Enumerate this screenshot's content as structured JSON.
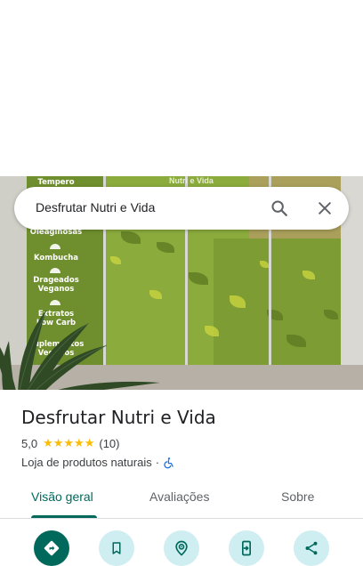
{
  "search": {
    "query": "Desfrutar Nutri e Vida",
    "search_icon": "search-icon",
    "close_icon": "close-icon"
  },
  "photo": {
    "sign_items": [
      "Tempero",
      "Oleaginosas",
      "Kombucha",
      "Drageados",
      "Veganos",
      "Extratos",
      "Low Carb",
      "Suplementos",
      "Veganos"
    ],
    "storefront_text": "Nutri e Vida"
  },
  "place": {
    "name": "Desfrutar Nutri e Vida",
    "rating": "5,0",
    "stars": "★★★★★",
    "review_count": "(10)",
    "category": "Loja de produtos naturais",
    "separator": "·",
    "accessibility_icon": "wheelchair-icon"
  },
  "tabs": [
    {
      "label": "Visão geral",
      "active": true
    },
    {
      "label": "Avaliações",
      "active": false
    },
    {
      "label": "Sobre",
      "active": false
    }
  ],
  "actions": [
    {
      "icon": "directions-icon",
      "primary": true
    },
    {
      "icon": "bookmark-icon",
      "primary": false
    },
    {
      "icon": "nearby-icon",
      "primary": false
    },
    {
      "icon": "send-to-phone-icon",
      "primary": false
    },
    {
      "icon": "share-icon",
      "primary": false
    }
  ],
  "colors": {
    "accent": "#00695c",
    "action_bg": "#cfeef2",
    "star": "#fbbc04",
    "accessibility": "#1a73e8"
  }
}
